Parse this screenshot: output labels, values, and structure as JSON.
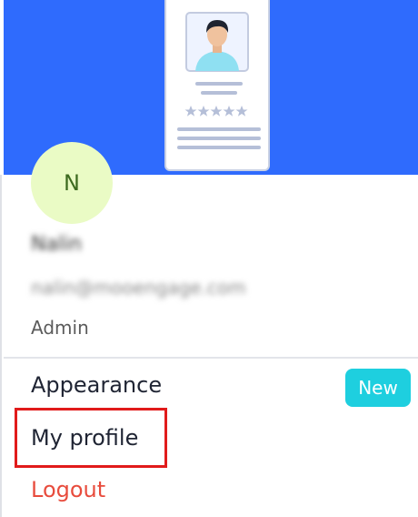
{
  "profile": {
    "avatar_initial": "N",
    "name": "Nalin",
    "email": "nalin@mooengage.com",
    "role": "Admin"
  },
  "menu": {
    "appearance_label": "Appearance",
    "appearance_badge": "New",
    "my_profile_label": "My profile",
    "logout_label": "Logout"
  },
  "colors": {
    "banner": "#2f6bfd",
    "avatar_bg": "#eafbc5",
    "badge": "#1ecfdf",
    "logout": "#e84c3d",
    "highlight": "#e11b1b"
  },
  "illustration": {
    "icon": "profile-card-illustration",
    "star_count": 5
  }
}
